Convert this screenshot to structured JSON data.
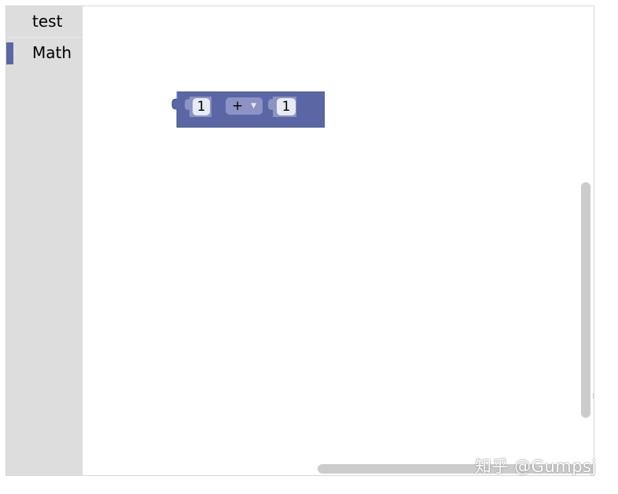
{
  "toolbox": {
    "categories": [
      {
        "label": "test",
        "color": "#dddddd",
        "selected": false
      },
      {
        "label": "Math",
        "color": "#5b67a5",
        "selected": true
      }
    ]
  },
  "workspace": {
    "block": {
      "type": "math_arithmetic",
      "color": "#5b67a5",
      "left_value": "1",
      "operator": "+",
      "right_value": "1"
    },
    "trash_icon": "trash-can-icon"
  },
  "watermark": "知乎 @Gumpsj"
}
